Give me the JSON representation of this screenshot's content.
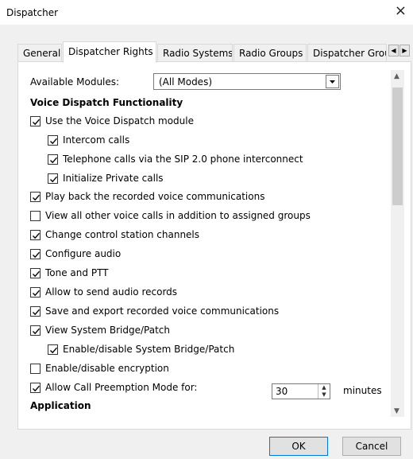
{
  "window": {
    "title": "Dispatcher",
    "close_glyph": "×"
  },
  "tabs": [
    {
      "label": "General"
    },
    {
      "label": "Dispatcher Rights"
    },
    {
      "label": "Radio Systems"
    },
    {
      "label": "Radio Groups"
    },
    {
      "label": "Dispatcher Grou"
    }
  ],
  "modules": {
    "label": "Available Modules:",
    "value": "(All Modes)"
  },
  "sections": {
    "voice": "Voice Dispatch Functionality",
    "application": "Application"
  },
  "items": [
    {
      "label": "Use the Voice Dispatch module",
      "checked": true
    },
    {
      "label": "Intercom calls",
      "checked": true
    },
    {
      "label": "Telephone calls via the SIP 2.0 phone interconnect",
      "checked": true
    },
    {
      "label": "Initialize Private calls",
      "checked": true
    },
    {
      "label": "Play back the recorded voice communications",
      "checked": true
    },
    {
      "label": "View all other voice calls in addition to assigned groups",
      "checked": false
    },
    {
      "label": "Change control station channels",
      "checked": true
    },
    {
      "label": "Configure audio",
      "checked": true
    },
    {
      "label": "Tone and PTT",
      "checked": true
    },
    {
      "label": "Allow to send audio records",
      "checked": true
    },
    {
      "label": "Save and export recorded voice communications",
      "checked": true
    },
    {
      "label": "View System Bridge/Patch",
      "checked": true
    },
    {
      "label": "Enable/disable System Bridge/Patch",
      "checked": true
    },
    {
      "label": "Enable/disable encryption",
      "checked": false
    },
    {
      "label": "Allow Call Preemption Mode for:",
      "checked": true
    }
  ],
  "preemption": {
    "value": "30",
    "unit": "minutes"
  },
  "buttons": {
    "ok": "OK",
    "cancel": "Cancel"
  }
}
